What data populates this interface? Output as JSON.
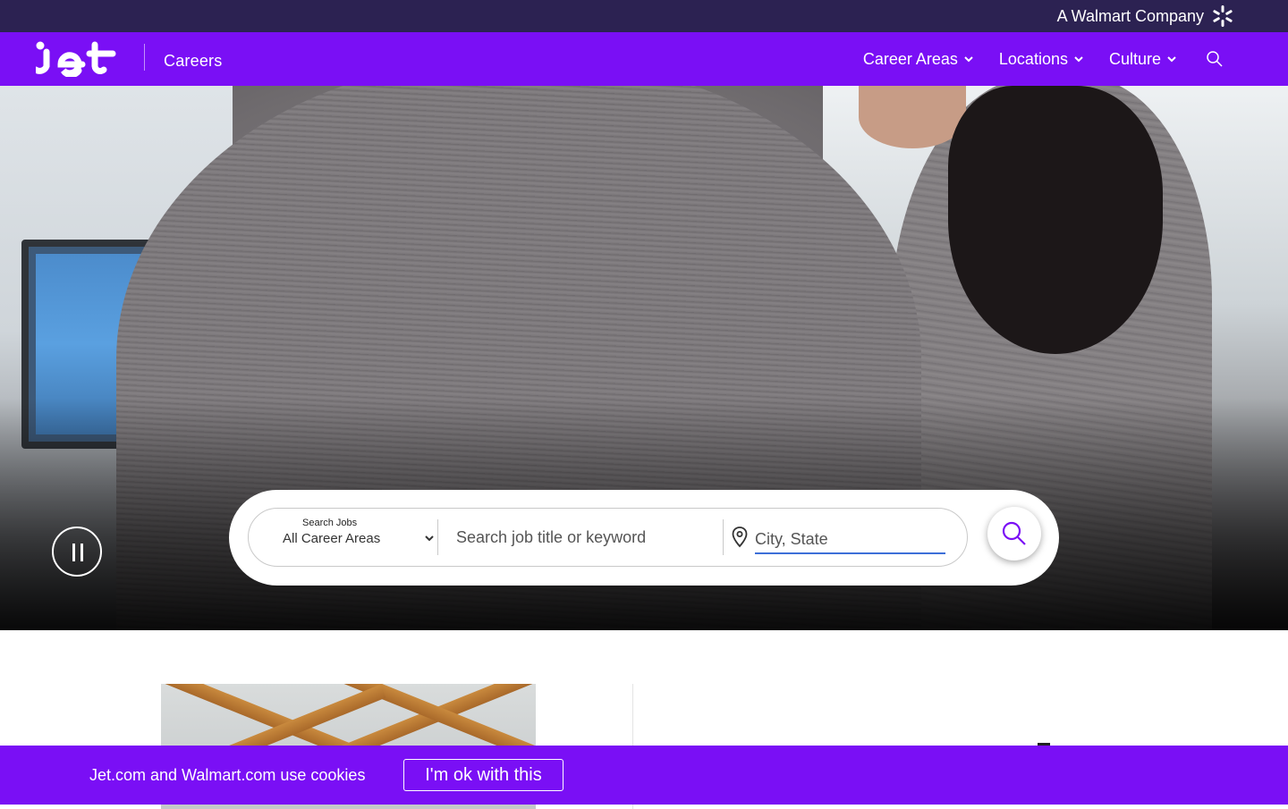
{
  "topbar": {
    "walmart_text": "A Walmart Company",
    "icon": "walmart-spark-icon"
  },
  "nav": {
    "logo": "jet",
    "section_title": "Careers",
    "menu": [
      {
        "label": "Career Areas"
      },
      {
        "label": "Locations"
      },
      {
        "label": "Culture"
      }
    ],
    "search_icon": "search-icon"
  },
  "hero": {
    "pause_icon": "pause-icon"
  },
  "search": {
    "legend": "Search Jobs",
    "career_select_value": "All Career Areas",
    "keyword_placeholder": "Search job title or keyword",
    "location_placeholder": "City, State",
    "submit_icon": "search-icon"
  },
  "cookie": {
    "text": "Jet.com and Walmart.com use cookies",
    "button_label": "I'm ok with this"
  },
  "colors": {
    "topbar_bg": "#2c2252",
    "nav_bg": "#7a0ff5",
    "cookie_bg": "#7a0ff5",
    "accent_underline": "#3d6fd8"
  }
}
